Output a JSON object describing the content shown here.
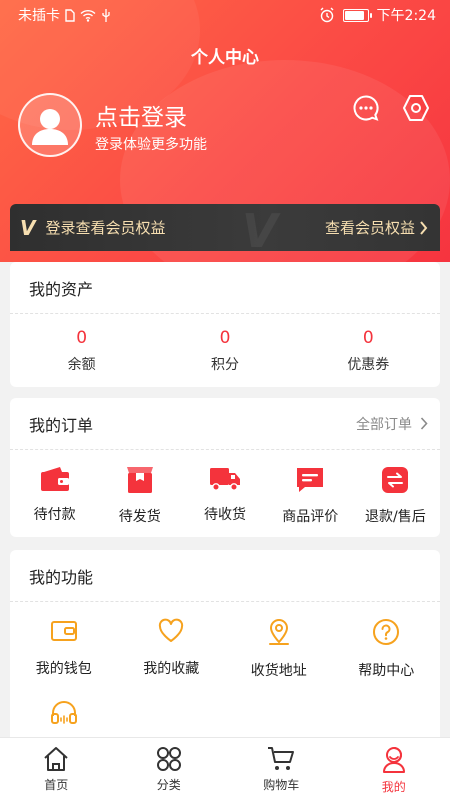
{
  "status": {
    "carrier": "未插卡",
    "time": "下午2:24",
    "battery_level": 0.9
  },
  "header": {
    "title": "个人中心",
    "login_title": "点击登录",
    "login_subtitle": "登录体验更多功能",
    "icons": [
      "message-icon",
      "settings-icon"
    ]
  },
  "vip": {
    "logo": "V",
    "label": "登录查看会员权益",
    "link": "查看会员权益"
  },
  "assets": {
    "title": "我的资产",
    "items": [
      {
        "value": "0",
        "label": "余额"
      },
      {
        "value": "0",
        "label": "积分"
      },
      {
        "value": "0",
        "label": "优惠券"
      }
    ]
  },
  "orders": {
    "title": "我的订单",
    "link": "全部订单",
    "items": [
      {
        "label": "待付款",
        "icon": "wallet-icon"
      },
      {
        "label": "待发货",
        "icon": "package-icon"
      },
      {
        "label": "待收货",
        "icon": "truck-icon"
      },
      {
        "label": "商品评价",
        "icon": "comment-icon"
      },
      {
        "label": "退款/售后",
        "icon": "refund-icon"
      }
    ]
  },
  "features": {
    "title": "我的功能",
    "items": [
      {
        "label": "我的钱包",
        "icon": "wallet-outline-icon"
      },
      {
        "label": "我的收藏",
        "icon": "heart-icon"
      },
      {
        "label": "收货地址",
        "icon": "location-icon"
      },
      {
        "label": "帮助中心",
        "icon": "help-icon"
      },
      {
        "label": "",
        "icon": "headset-icon"
      }
    ]
  },
  "colors": {
    "accent": "#f4333c",
    "feature_icon": "#f6a21e",
    "gold": "#f6deb0"
  },
  "tabs": [
    {
      "label": "首页",
      "icon": "home-icon"
    },
    {
      "label": "分类",
      "icon": "category-icon"
    },
    {
      "label": "购物车",
      "icon": "cart-icon"
    },
    {
      "label": "我的",
      "icon": "profile-icon",
      "active": true
    }
  ]
}
